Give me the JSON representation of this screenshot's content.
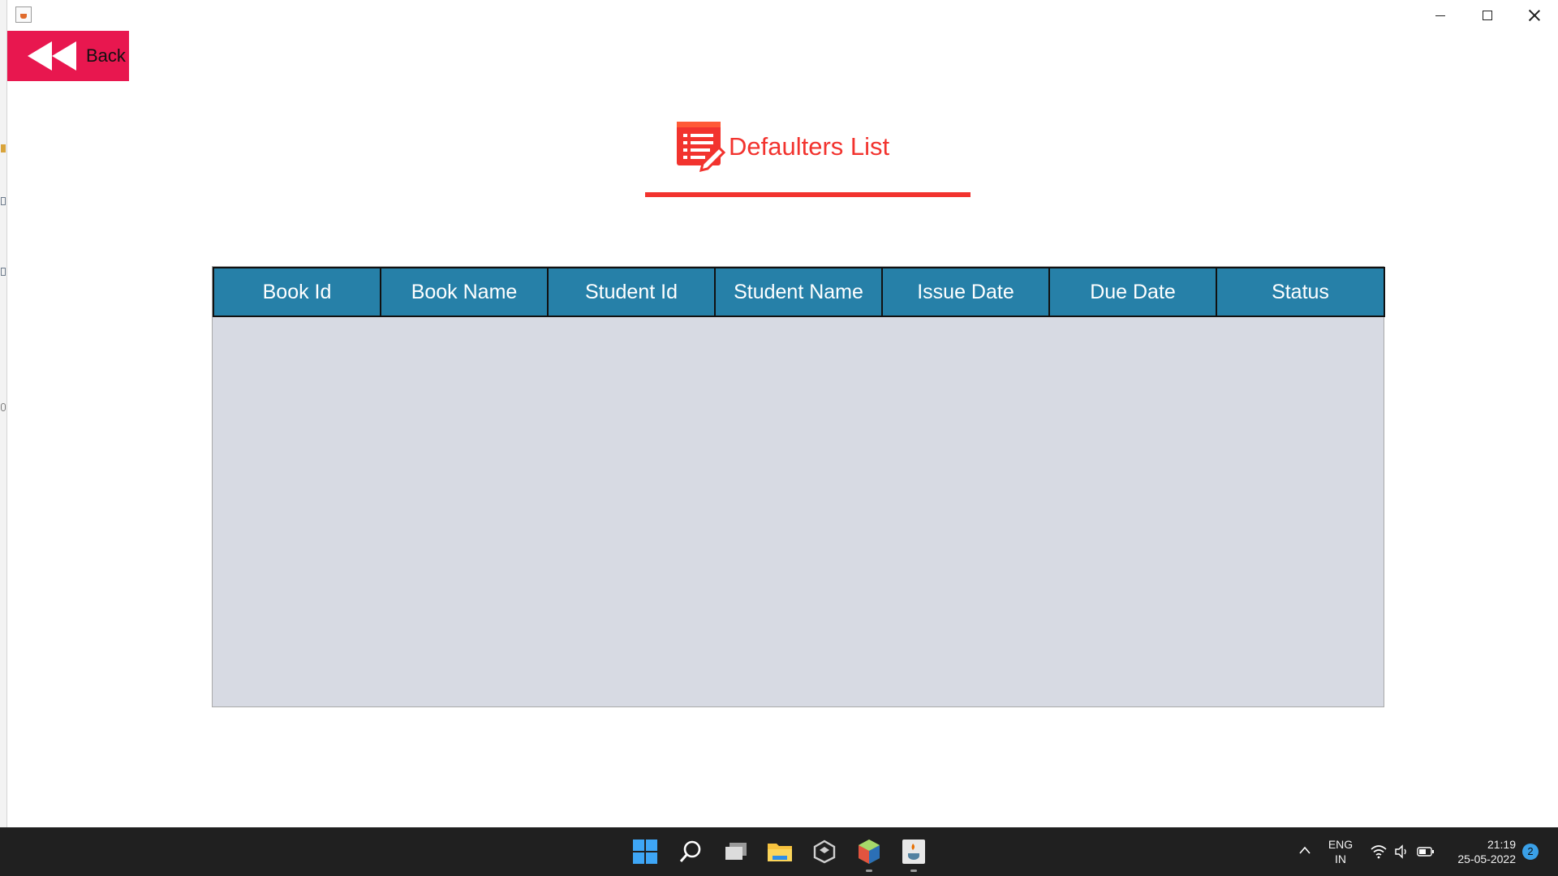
{
  "window": {
    "back_label": "Back",
    "heading": "Defaulters List"
  },
  "table": {
    "columns": [
      "Book Id",
      "Book Name",
      "Student Id",
      "Student Name",
      "Issue Date",
      "Due Date",
      "Status"
    ],
    "rows": []
  },
  "taskbar": {
    "apps": [
      "start-icon",
      "search-icon",
      "task-view-icon",
      "file-explorer-icon",
      "unity-icon",
      "netbeans-icon",
      "java-icon"
    ],
    "lang_line1": "ENG",
    "lang_line2": "IN",
    "time": "21:19",
    "date": "25-05-2022",
    "notification_count": "2"
  },
  "colors": {
    "back_button": "#e8174f",
    "accent_red": "#f2332e",
    "table_header": "#2680a8",
    "table_body": "#d7dae3",
    "taskbar": "#202020"
  }
}
